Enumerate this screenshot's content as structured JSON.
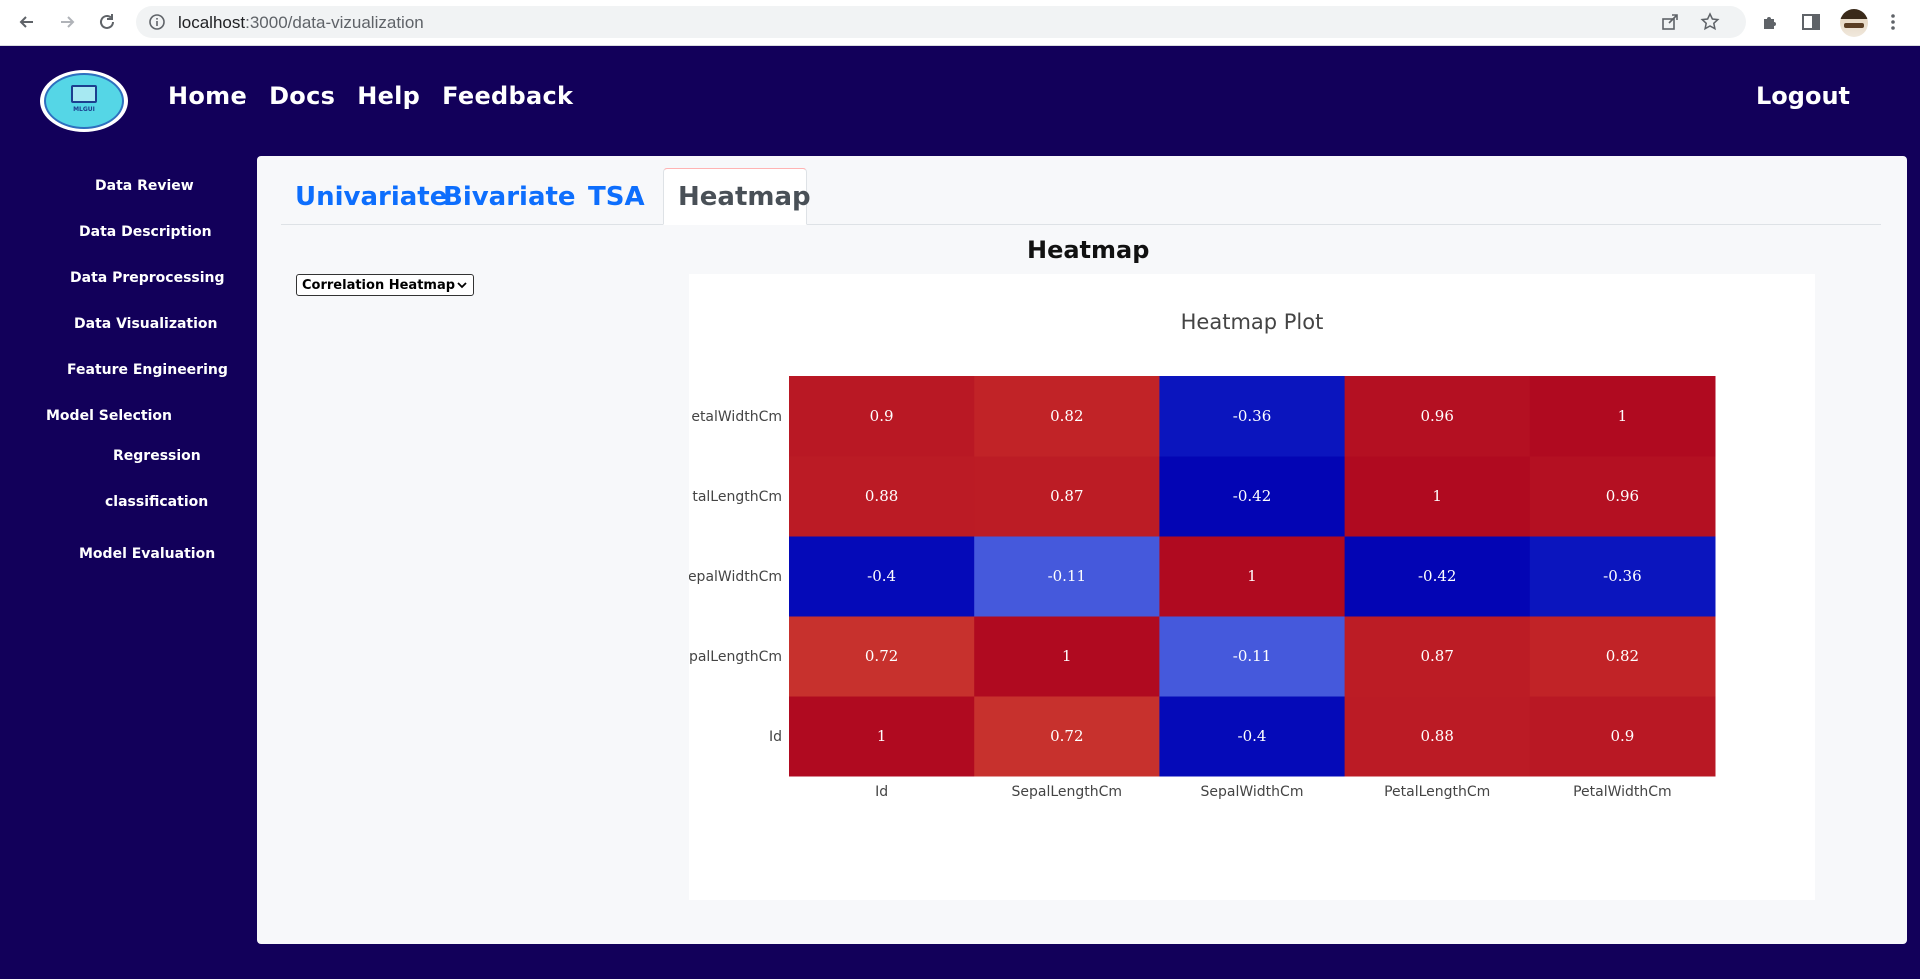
{
  "browser": {
    "url_host": "localhost",
    "url_path": ":3000/data-vizualization"
  },
  "header": {
    "logo_alt": "MLGUI",
    "nav": [
      "Home",
      "Docs",
      "Help",
      "Feedback"
    ],
    "logout": "Logout"
  },
  "sidebar": {
    "items": [
      "Data Review",
      "Data Description",
      "Data Preprocessing",
      "Data Visualization",
      "Feature Engineering",
      "Model Selection",
      "Regression",
      "classification",
      "Model Evaluation"
    ]
  },
  "tabs": [
    "Univariate",
    "Bivariate",
    "TSA",
    "Heatmap"
  ],
  "active_tab": "Heatmap",
  "section_title": "Heatmap",
  "select": {
    "value": "Correlation Heatmap"
  },
  "chart_data": {
    "type": "heatmap",
    "title": "Heatmap Plot",
    "x": [
      "Id",
      "SepalLengthCm",
      "SepalWidthCm",
      "PetalLengthCm",
      "PetalWidthCm"
    ],
    "y": [
      "Id",
      "SepalLengthCm",
      "SepalWidthCm",
      "PetalLengthCm",
      "PetalWidthCm"
    ],
    "y_tick_labels_visible": [
      "Id",
      "palLengthCm",
      "epalWidthCm",
      "talLengthCm",
      "etalWidthCm"
    ],
    "z": [
      [
        1,
        0.72,
        -0.4,
        0.88,
        0.9
      ],
      [
        0.72,
        1,
        -0.11,
        0.87,
        0.82
      ],
      [
        -0.4,
        -0.11,
        1,
        -0.42,
        -0.36
      ],
      [
        0.88,
        0.87,
        -0.42,
        1,
        0.96
      ],
      [
        0.9,
        0.82,
        -0.36,
        0.96,
        1
      ]
    ],
    "colorscale": "coolwarm",
    "zlim": [
      -0.42,
      1
    ]
  },
  "colors": {
    "background": "#12005a",
    "panel": "#f7f8fa",
    "tab_link": "#0d6efd"
  }
}
